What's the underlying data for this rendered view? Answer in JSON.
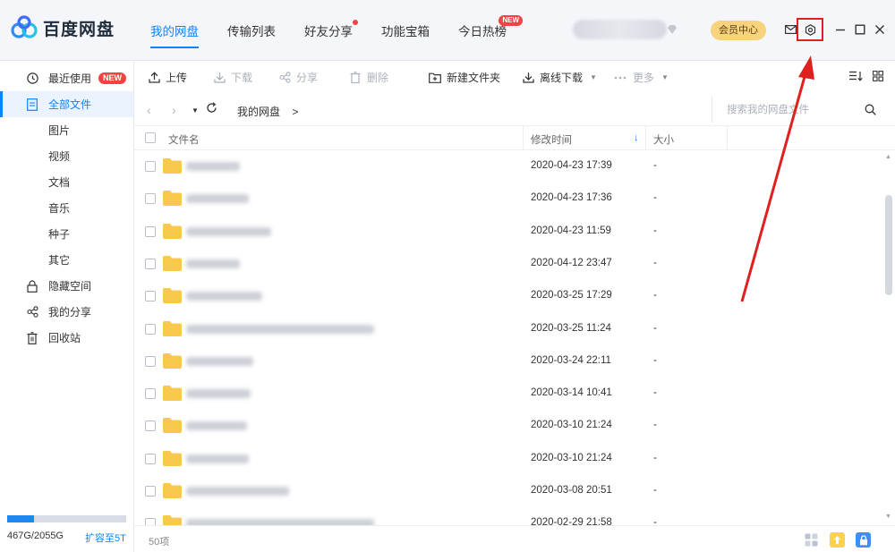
{
  "app": {
    "name": "百度网盘"
  },
  "nav": {
    "tabs": [
      {
        "label": "我的网盘",
        "active": true
      },
      {
        "label": "传输列表"
      },
      {
        "label": "好友分享",
        "dot": true
      },
      {
        "label": "功能宝箱"
      },
      {
        "label": "今日热榜",
        "badge": "NEW"
      }
    ]
  },
  "header": {
    "vip_label": "会员中心",
    "icons": [
      "mail-icon",
      "settings-icon",
      "minimize-icon",
      "maximize-icon",
      "close-icon"
    ]
  },
  "sidebar": {
    "items": [
      {
        "label": "最近使用",
        "icon": "clock-icon",
        "badge": "NEW"
      },
      {
        "label": "全部文件",
        "icon": "document-icon",
        "active": true
      },
      {
        "label": "图片"
      },
      {
        "label": "视频"
      },
      {
        "label": "文档"
      },
      {
        "label": "音乐"
      },
      {
        "label": "种子"
      },
      {
        "label": "其它"
      },
      {
        "label": "隐藏空间",
        "icon": "lock-icon"
      },
      {
        "label": "我的分享",
        "icon": "share-icon"
      },
      {
        "label": "回收站",
        "icon": "trash-icon"
      }
    ],
    "quota": {
      "used_text": "467G/2055G",
      "expand_label": "扩容至5T",
      "fraction": 0.227
    }
  },
  "toolbar": {
    "upload": "上传",
    "download": "下载",
    "share": "分享",
    "delete": "删除",
    "new_folder": "新建文件夹",
    "offline": "离线下载",
    "more": "更多"
  },
  "path": {
    "current": "我的网盘",
    "separator": ">",
    "search_placeholder": "搜索我的网盘文件"
  },
  "table": {
    "columns": {
      "name": "文件名",
      "modified": "修改时间",
      "size": "大小"
    },
    "rows": [
      {
        "date": "2020-04-23 17:39",
        "size": "-"
      },
      {
        "date": "2020-04-23 17:36",
        "size": "-"
      },
      {
        "date": "2020-04-23 11:59",
        "size": "-"
      },
      {
        "date": "2020-04-12 23:47",
        "size": "-"
      },
      {
        "date": "2020-03-25 17:29",
        "size": "-"
      },
      {
        "date": "2020-03-25 11:24",
        "size": "-"
      },
      {
        "date": "2020-03-24 22:11",
        "size": "-"
      },
      {
        "date": "2020-03-14 10:41",
        "size": "-"
      },
      {
        "date": "2020-03-10 21:24",
        "size": "-"
      },
      {
        "date": "2020-03-10 21:24",
        "size": "-"
      },
      {
        "date": "2020-03-08 20:51",
        "size": "-"
      },
      {
        "date": "2020-02-29 21:58",
        "size": "-"
      }
    ]
  },
  "status": {
    "count": "50项"
  },
  "colors": {
    "accent": "#0c83ff",
    "badge": "#f54343",
    "folder": "#f9c84c",
    "highlight": "#e01f1f"
  }
}
